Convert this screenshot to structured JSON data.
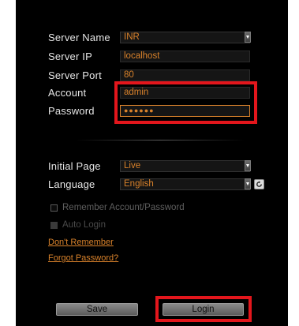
{
  "form": {
    "server_name": {
      "label": "Server Name",
      "value": "INR"
    },
    "server_ip": {
      "label": "Server IP",
      "value": "localhost"
    },
    "server_port": {
      "label": "Server Port",
      "value": "80"
    },
    "account": {
      "label": "Account",
      "value": "admin"
    },
    "password": {
      "label": "Password",
      "value": "●●●●●●"
    },
    "initial_page": {
      "label": "Initial Page",
      "value": "Live"
    },
    "language": {
      "label": "Language",
      "value": "English"
    }
  },
  "options": {
    "remember_label": "Remember Account/Password",
    "auto_login_label": "Auto Login",
    "dont_remember_link": "Don't Remember",
    "forgot_password_link": "Forgot Password?"
  },
  "buttons": {
    "save_label": "Save",
    "login_label": "Login"
  },
  "colors": {
    "accent": "#d9822b",
    "highlight": "#e3161c",
    "background": "#000000"
  },
  "icons": {
    "dropdown": "chevron-down-icon",
    "refresh": "refresh-icon"
  }
}
